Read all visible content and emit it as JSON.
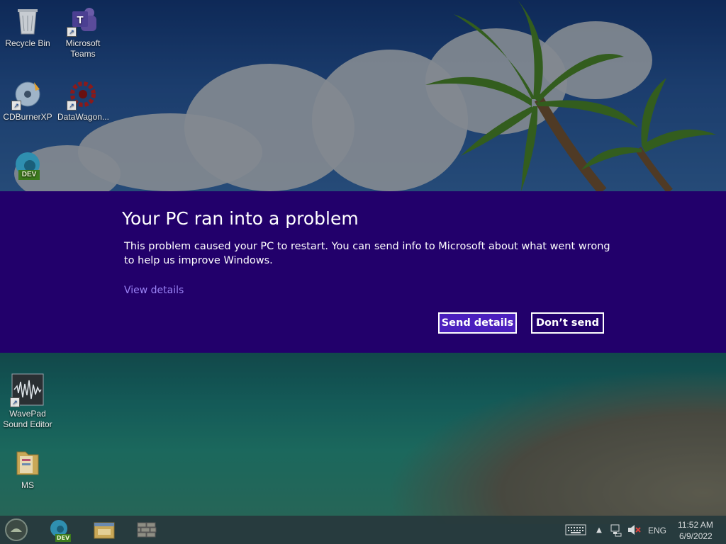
{
  "desktop": {
    "icons": [
      {
        "label_line1": "Recycle Bin",
        "label_line2": ""
      },
      {
        "label_line1": "Microsoft",
        "label_line2": "Teams"
      },
      {
        "label_line1": "CDBurnerXP",
        "label_line2": ""
      },
      {
        "label_line1": "DataWagon...",
        "label_line2": ""
      },
      {
        "label_line1": "",
        "label_line2": "",
        "badge": "DEV"
      },
      {
        "label_line1": "WavePad",
        "label_line2": "Sound Editor"
      },
      {
        "label_line1": "MS",
        "label_line2": ""
      }
    ]
  },
  "dialog": {
    "title": "Your PC ran into a problem",
    "body": "This problem caused your PC to restart. You can send info to Microsoft about what went wrong to help us improve Windows.",
    "view_details": "View details",
    "send_button": "Send details",
    "dont_send_button": "Don’t send",
    "colors": {
      "background": "#22006b",
      "primary_button": "#4b1fbe",
      "link": "#9a83f5"
    }
  },
  "taskbar": {
    "edge_badge": "DEV",
    "tray": {
      "language": "ENG",
      "time": "11:52 AM",
      "date": "6/9/2022"
    }
  }
}
